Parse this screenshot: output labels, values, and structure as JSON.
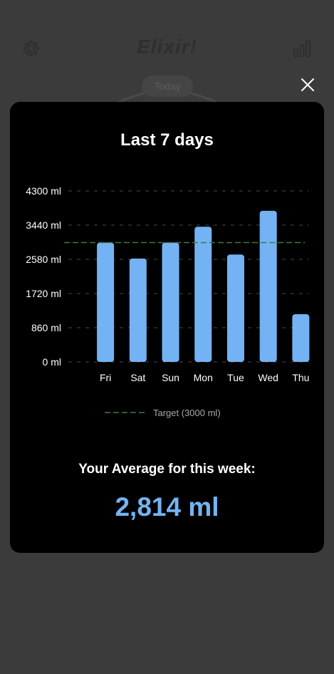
{
  "app": {
    "title": "Elixir!",
    "today_label": "Today",
    "settings_icon": "gear-icon",
    "stats_icon": "bar-chart-icon",
    "close_icon": "close-icon"
  },
  "modal": {
    "title": "Last 7 days",
    "average_label": "Your Average for this week:",
    "average_value": "2,814 ml"
  },
  "colors": {
    "bar": "#74b3f3",
    "target_line": "#3f7a3f",
    "grid": "#4a4a4a",
    "background": "#3b3b3b",
    "card": "#000000"
  },
  "chart_data": {
    "type": "bar",
    "categories": [
      "Fri",
      "Sat",
      "Sun",
      "Mon",
      "Tue",
      "Wed",
      "Thu"
    ],
    "values": [
      3000,
      2600,
      3000,
      3400,
      2700,
      3800,
      1200
    ],
    "yticks": [
      0,
      860,
      1720,
      2580,
      3440,
      4300
    ],
    "ytick_labels": [
      "0 ml",
      "860 ml",
      "1720 ml",
      "2580 ml",
      "3440 ml",
      "4300 ml"
    ],
    "ylim": [
      0,
      4300
    ],
    "target": 3000,
    "legend": [
      "Target (3000 ml)"
    ],
    "legend_position": "bottom-center",
    "grid": true
  }
}
